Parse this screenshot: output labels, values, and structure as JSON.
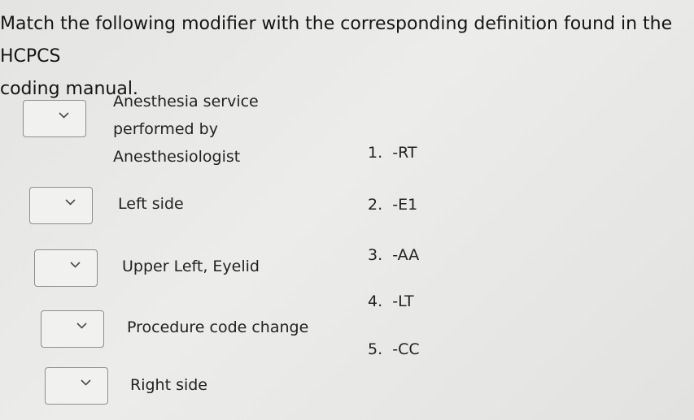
{
  "question": {
    "prompt_line1": "Match the following modifier with the corresponding definition found in the HCPCS",
    "prompt_line2": "coding manual."
  },
  "rows": [
    {
      "label_lines": [
        "Anesthesia service",
        "performed by",
        "Anesthesiologist"
      ],
      "selected": ""
    },
    {
      "label_lines": [
        "Left side"
      ],
      "selected": ""
    },
    {
      "label_lines": [
        "Upper Left, Eyelid"
      ],
      "selected": ""
    },
    {
      "label_lines": [
        "Procedure code change"
      ],
      "selected": ""
    },
    {
      "label_lines": [
        "Right side"
      ],
      "selected": ""
    }
  ],
  "options": [
    {
      "number": "1.",
      "code": "-RT"
    },
    {
      "number": "2.",
      "code": "-E1"
    },
    {
      "number": "3.",
      "code": "-AA"
    },
    {
      "number": "4.",
      "code": "-LT"
    },
    {
      "number": "5.",
      "code": "-CC"
    }
  ],
  "icons": {
    "dropdown": "chevron-down-icon"
  }
}
